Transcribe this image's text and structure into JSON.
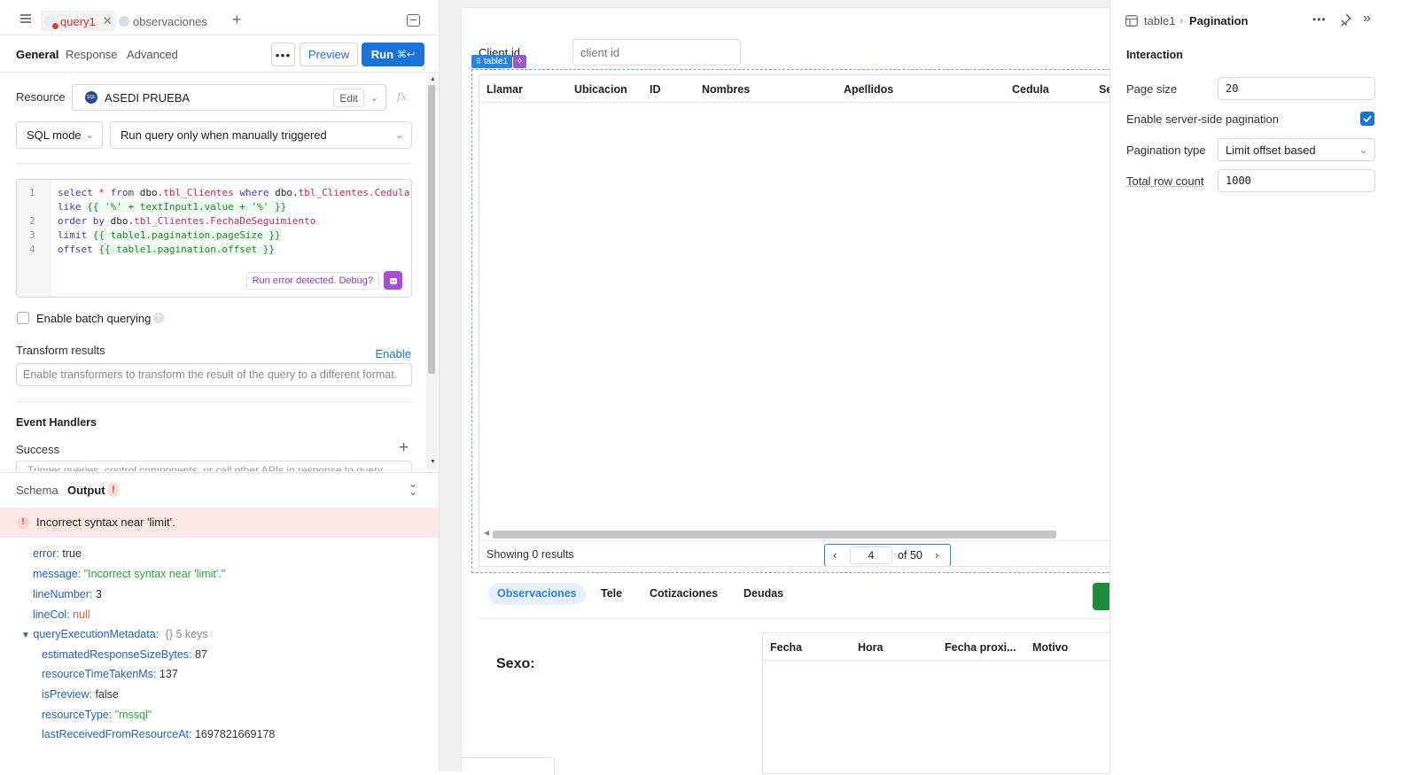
{
  "query_tabs": [
    {
      "label": "query1",
      "active": true
    },
    {
      "label": "observaciones",
      "active": false
    }
  ],
  "subtabs": {
    "general": "General",
    "response": "Response",
    "advanced": "Advanced"
  },
  "toolbar": {
    "preview": "Preview",
    "run": "Run",
    "run_shortcut": "⌘↩"
  },
  "resource": {
    "label": "Resource",
    "name": "ASEDI PRUEBA",
    "badge": "SQL",
    "edit": "Edit",
    "fx": "fx"
  },
  "mode": {
    "sql_mode": "SQL mode",
    "trigger": "Run query only when manually triggered"
  },
  "code_lines": [
    {
      "n": "1",
      "parts": [
        [
          "kw",
          "select "
        ],
        [
          "id",
          "* "
        ],
        [
          "kw",
          "from "
        ],
        [
          "p",
          "dbo."
        ],
        [
          "id",
          "tbl_Clientes "
        ],
        [
          "kw",
          "where "
        ],
        [
          "p",
          "dbo."
        ],
        [
          "id",
          "tbl_Clientes.Cedula"
        ]
      ]
    },
    {
      "n": "",
      "parts": [
        [
          "kw",
          "like "
        ],
        [
          "tpl",
          "{{ '%' + textInput1.value + '%' }}"
        ]
      ]
    },
    {
      "n": "2",
      "parts": [
        [
          "kw",
          "order by "
        ],
        [
          "p",
          "dbo."
        ],
        [
          "id",
          "tbl_Clientes.FechaDeSeguimiento"
        ]
      ]
    },
    {
      "n": "3",
      "parts": [
        [
          "kw",
          "limit "
        ],
        [
          "tpl",
          "{{ table1.pagination.pageSize }}"
        ]
      ]
    },
    {
      "n": "4",
      "parts": [
        [
          "kw",
          "offset "
        ],
        [
          "tpl",
          "{{ table1.pagination.offset }}"
        ]
      ]
    }
  ],
  "debug": "Run error detected. Debug?",
  "batch": "Enable batch querying",
  "transform": {
    "label": "Transform results",
    "enable": "Enable",
    "placeholder": "Enable transformers to transform the result of the query to a different format."
  },
  "events": {
    "title": "Event Handlers",
    "success": "Success",
    "hint": "Trigger queries, control components, or call other APIs in response to query"
  },
  "bottom_tabs": {
    "schema": "Schema",
    "output": "Output"
  },
  "error_banner": "Incorrect syntax near 'limit'.",
  "output": {
    "error": "true",
    "message": "\"Incorrect syntax near 'limit'.\"",
    "lineNumber": "3",
    "lineCol": "null",
    "qem_label": "queryExecutionMetadata:",
    "qem_summary": "{} 5 keys",
    "estimatedResponseSizeBytes": "87",
    "resourceTimeTakenMs": "137",
    "isPreview": "false",
    "resourceType": "\"mssql\"",
    "lastReceivedFromResourceAt": "1697821669178"
  },
  "canvas": {
    "client_label": "Client id",
    "client_placeholder": "client id",
    "table_tag": "table1",
    "columns": [
      "Llamar",
      "Ubicacion",
      "ID",
      "Nombres",
      "Apellidos",
      "Cedula",
      "Se"
    ],
    "showing": "Showing 0 results",
    "page_value": "4",
    "page_of": "of 50",
    "tabs": [
      "Observaciones",
      "Tele",
      "Cotizaciones",
      "Deudas"
    ],
    "sexo": "Sexo:",
    "sub_columns": [
      "Fecha",
      "Hora",
      "Fecha proxi...",
      "Motivo"
    ]
  },
  "inspector": {
    "crumb_component": "table1",
    "crumb_section": "Pagination",
    "section": "Interaction",
    "page_size_label": "Page size",
    "page_size": "20",
    "server_side_label": "Enable server-side pagination",
    "pagination_type_label": "Pagination type",
    "pagination_type": "Limit offset based",
    "total_row_count_label": "Total row count",
    "total_row_count": "1000"
  },
  "colors": {
    "accent": "#1a73d9",
    "error": "#e03a3a",
    "error_bg": "#fde8e8",
    "success_btn": "#1e8e3e"
  }
}
